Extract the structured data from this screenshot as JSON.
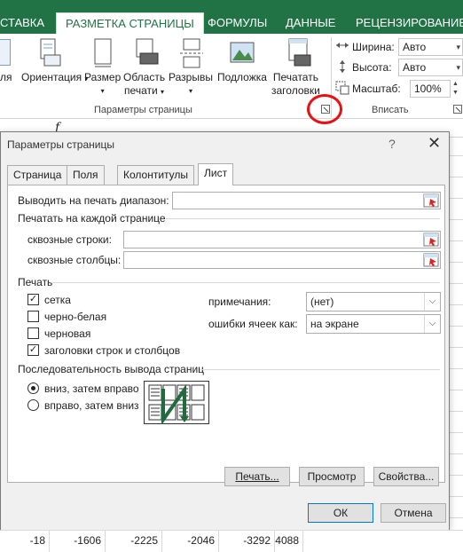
{
  "ribbon": {
    "tabs": [
      "СТАВКА",
      "РАЗМЕТКА СТРАНИЦЫ",
      "ФОРМУЛЫ",
      "ДАННЫЕ",
      "РЕЦЕНЗИРОВАНИЕ"
    ],
    "buttons": {
      "fields_partial": "ля",
      "orientation": "Ориентация",
      "size": "Размер",
      "print_area_1": "Область",
      "print_area_2": "печати",
      "breaks": "Разрывы",
      "background": "Подложка",
      "print_titles_1": "Печатать",
      "print_titles_2": "заголовки"
    },
    "group_page_setup": "Параметры страницы",
    "fit": {
      "width_label": "Ширина:",
      "width_value": "Авто",
      "height_label": "Высота:",
      "height_value": "Авто",
      "scale_label": "Масштаб:",
      "scale_value": "100%",
      "group_label": "Вписать"
    }
  },
  "dialog": {
    "title": "Параметры страницы",
    "help": "?",
    "close": "✕",
    "tabs": [
      "Страница",
      "Поля",
      "Колонтитулы",
      "Лист"
    ],
    "print_area_label": "Выводить на печать диапазон:",
    "print_titles_label": "Печатать на каждой странице",
    "rows_label": "сквозные строки:",
    "cols_label": "сквозные столбцы:",
    "print_section": "Печать",
    "options": [
      {
        "label": "сетка",
        "checked": true
      },
      {
        "label": "черно-белая",
        "checked": false
      },
      {
        "label": "черновая",
        "checked": false
      },
      {
        "label": "заголовки строк и столбцов",
        "checked": true
      }
    ],
    "comments_label": "примечания:",
    "comments_value": "(нет)",
    "errors_label": "ошибки ячеек как:",
    "errors_value": "на экране",
    "order_section": "Последовательность вывода страниц",
    "order_options": [
      {
        "label": "вниз, затем вправо",
        "selected": true
      },
      {
        "label": "вправо, затем вниз",
        "selected": false
      }
    ],
    "btn_print": "Печать...",
    "btn_preview": "Просмотр",
    "btn_properties": "Свойства...",
    "btn_ok": "ОК",
    "btn_cancel": "Отмена"
  },
  "sheet": {
    "fx": "f",
    "bottom_values": [
      "-18",
      "-1606",
      "-2225",
      "-2046",
      "-3292",
      "4088"
    ]
  }
}
